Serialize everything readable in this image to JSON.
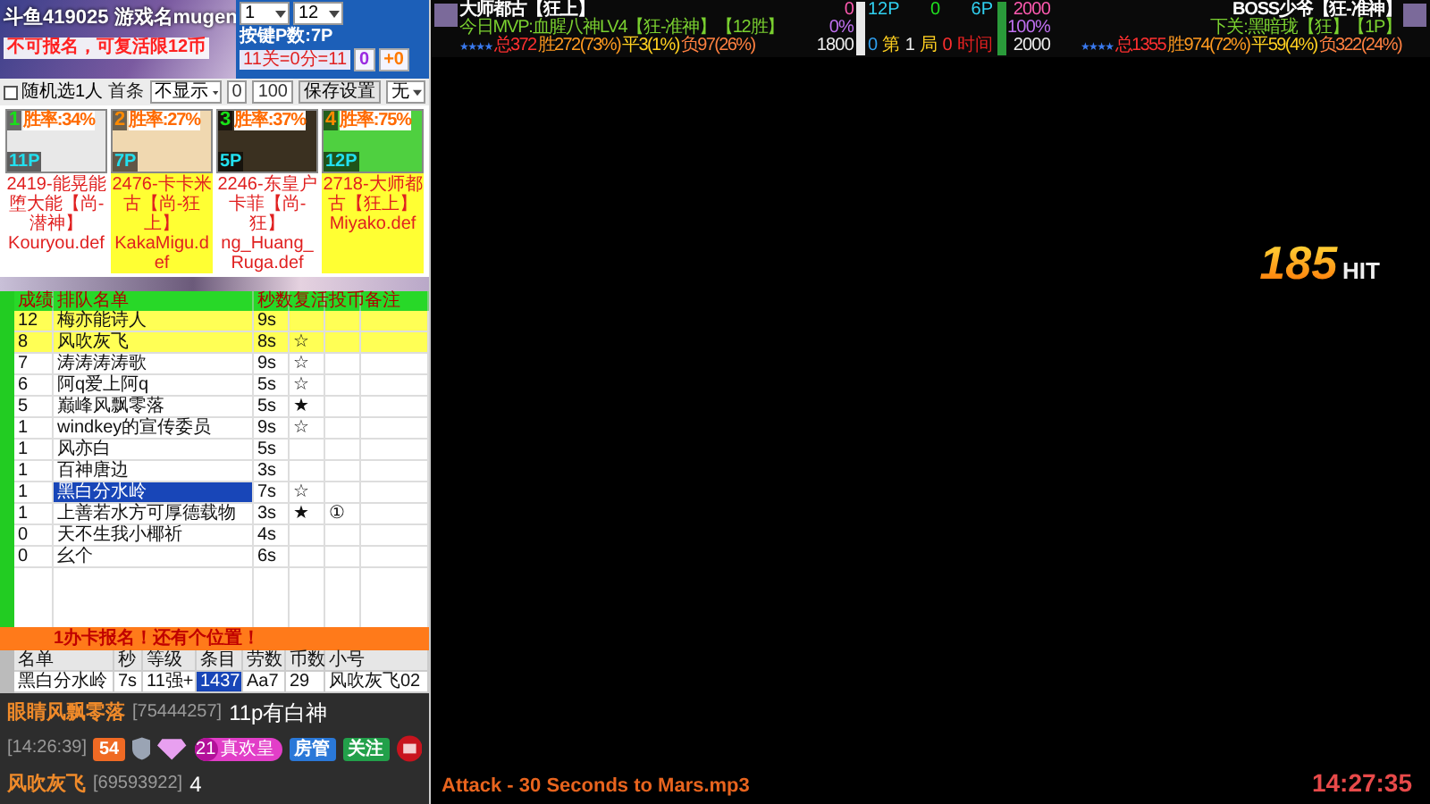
{
  "header": {
    "title": "斗鱼419025 游戏名mugen",
    "notice": "不可报名，可复活限12币",
    "select_1": "1",
    "select_2": "12",
    "key_p": "按键P数:7P",
    "score": "11关=0分=11",
    "counter": "0",
    "bonus": "+0"
  },
  "toolbar": {
    "random": "随机选1人",
    "random_checked": false,
    "first_label": "首条",
    "first_value": "不显示",
    "min": "0",
    "max": "100",
    "save": "保存设置",
    "load_value": "无"
  },
  "cards": [
    {
      "number": "1",
      "win_rate": "胜率:34%",
      "player": "11P",
      "name": "2419-能晃能堕大能【尚-潜神】",
      "file": "Kouryou.def",
      "highlighted": false
    },
    {
      "number": "2",
      "win_rate": "胜率:27%",
      "player": "7P",
      "name": "2476-卡卡米古【尚-狂上】",
      "file": "KakaMigu.def",
      "highlighted": true
    },
    {
      "number": "3",
      "win_rate": "胜率:37%",
      "player": "5P",
      "name": "2246-东皇户卡菲【尚-狂】",
      "file": "ng_Huang_Ruga.def",
      "highlighted": false
    },
    {
      "number": "4",
      "win_rate": "胜率:75%",
      "player": "12P",
      "name": "2718-大师都古【狂上】",
      "file": "Miyako.def",
      "highlighted": true
    }
  ],
  "queue": {
    "columns": [
      "成绩",
      "排队名单",
      "秒数",
      "复活",
      "投币",
      "备注"
    ],
    "rows": [
      {
        "score": "12",
        "name": "梅亦能诗人",
        "seconds": "9s",
        "revive": "",
        "coin": "",
        "highlighted": true,
        "selected": false
      },
      {
        "score": "8",
        "name": "风吹灰飞",
        "seconds": "8s",
        "revive": "☆",
        "coin": "",
        "highlighted": true,
        "selected": false
      },
      {
        "score": "7",
        "name": "涛涛涛涛歌",
        "seconds": "9s",
        "revive": "☆",
        "coin": "",
        "highlighted": false,
        "selected": false
      },
      {
        "score": "6",
        "name": "阿q爱上阿q",
        "seconds": "5s",
        "revive": "☆",
        "coin": "",
        "highlighted": false,
        "selected": false
      },
      {
        "score": "5",
        "name": "巅峰风飘零落",
        "seconds": "5s",
        "revive": "★",
        "coin": "",
        "highlighted": false,
        "selected": false
      },
      {
        "score": "1",
        "name": "windkey的宣传委员",
        "seconds": "9s",
        "revive": "☆",
        "coin": "",
        "highlighted": false,
        "selected": false
      },
      {
        "score": "1",
        "name": "风亦白",
        "seconds": "5s",
        "revive": "",
        "coin": "",
        "highlighted": false,
        "selected": false
      },
      {
        "score": "1",
        "name": "百神唐边",
        "seconds": "3s",
        "revive": "",
        "coin": "",
        "highlighted": false,
        "selected": false
      },
      {
        "score": "1",
        "name": "黑白分水岭",
        "seconds": "7s",
        "revive": "☆",
        "coin": "",
        "highlighted": false,
        "selected": true
      },
      {
        "score": "1",
        "name": "上善若水方可厚德载物",
        "seconds": "3s",
        "revive": "★",
        "coin": "①",
        "highlighted": false,
        "selected": false
      },
      {
        "score": "0",
        "name": "天不生我小椰祈",
        "seconds": "4s",
        "revive": "",
        "coin": "",
        "highlighted": false,
        "selected": false
      },
      {
        "score": "0",
        "name": "幺个",
        "seconds": "6s",
        "revive": "",
        "coin": "",
        "highlighted": false,
        "selected": false
      }
    ]
  },
  "notice_bar": "1办卡报名！还有个位置！",
  "current": {
    "columns": [
      "名单",
      "秒",
      "等级",
      "条目",
      "劳数",
      "币数",
      "小号"
    ],
    "cells": [
      {
        "text": "黑白分水岭",
        "selected": false
      },
      {
        "text": "7s",
        "selected": false
      },
      {
        "text": "11强+",
        "selected": false
      },
      {
        "text": "1437",
        "selected": true
      },
      {
        "text": "Aa7",
        "selected": false
      },
      {
        "text": "29",
        "selected": false
      },
      {
        "text": "风吹灰飞02",
        "selected": false
      }
    ]
  },
  "chat": [
    {
      "kind": "message",
      "user": "眼睛风飘零落",
      "uid": "[75444257]",
      "text": "11p有白神"
    },
    {
      "kind": "badges",
      "time": "[14:26:39]",
      "level": "54",
      "fan_level": "21",
      "fan_name": "真欢皇",
      "role": "房管",
      "follow": "关注"
    },
    {
      "kind": "message",
      "user": "风吹灰飞",
      "uid": "[69593922]",
      "text": "4"
    }
  ],
  "hud": {
    "left": {
      "name": "大师都古【狂上】",
      "sub": "今日MVP:血腥八神LV4【狂-准神】【12胜】",
      "stars": "★★★★",
      "total": "总372",
      "wins": "胜272(73%)",
      "draws": "平3(1%)",
      "losses": "负97(26%)",
      "life": "0",
      "percent": "0%",
      "power": "1800",
      "player": "12P",
      "level": 1
    },
    "right": {
      "name": "BOSS少爷【狂-准神】",
      "sub": "下关:黑暗珑【狂】【1P】",
      "stars": "★★★★",
      "total": "总1355",
      "wins": "胜974(72%)",
      "draws": "平59(4%)",
      "losses": "负322(24%)",
      "life": "2000",
      "percent": "100%",
      "power": "2000",
      "player": "6P",
      "level": 1
    },
    "center": {
      "top_score": "0",
      "left_wins": "0",
      "round_label": "第",
      "round": "1",
      "round_unit": "局",
      "right_wins": "0",
      "time_label": "时间"
    }
  },
  "stage": {
    "combo": "185",
    "combo_label": "HIT",
    "track": "Attack - 30 Seconds to Mars.mp3",
    "clock": "14:27:35"
  }
}
